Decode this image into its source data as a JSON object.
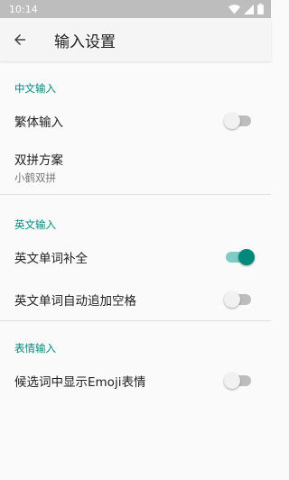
{
  "status_bar": {
    "time": "10:14",
    "icons": [
      "wifi-icon",
      "signal-icon",
      "battery-icon"
    ]
  },
  "app_bar": {
    "back_icon": "arrow-back-icon",
    "title": "输入设置"
  },
  "sections": {
    "chinese": {
      "header": "中文输入",
      "traditional": {
        "title": "繁体输入",
        "enabled": false
      },
      "double_pinyin": {
        "title": "双拼方案",
        "summary": "小鹤双拼"
      }
    },
    "english": {
      "header": "英文输入",
      "completion": {
        "title": "英文单词补全",
        "enabled": true
      },
      "auto_space": {
        "title": "英文单词自动追加空格",
        "enabled": false
      }
    },
    "emoji": {
      "header": "表情输入",
      "show_emoji": {
        "title": "候选词中显示Emoji表情",
        "enabled": false
      }
    }
  },
  "colors": {
    "accent": "#00897b",
    "accent_light": "#80cbc4",
    "status_bar": "#bdbdbd"
  }
}
